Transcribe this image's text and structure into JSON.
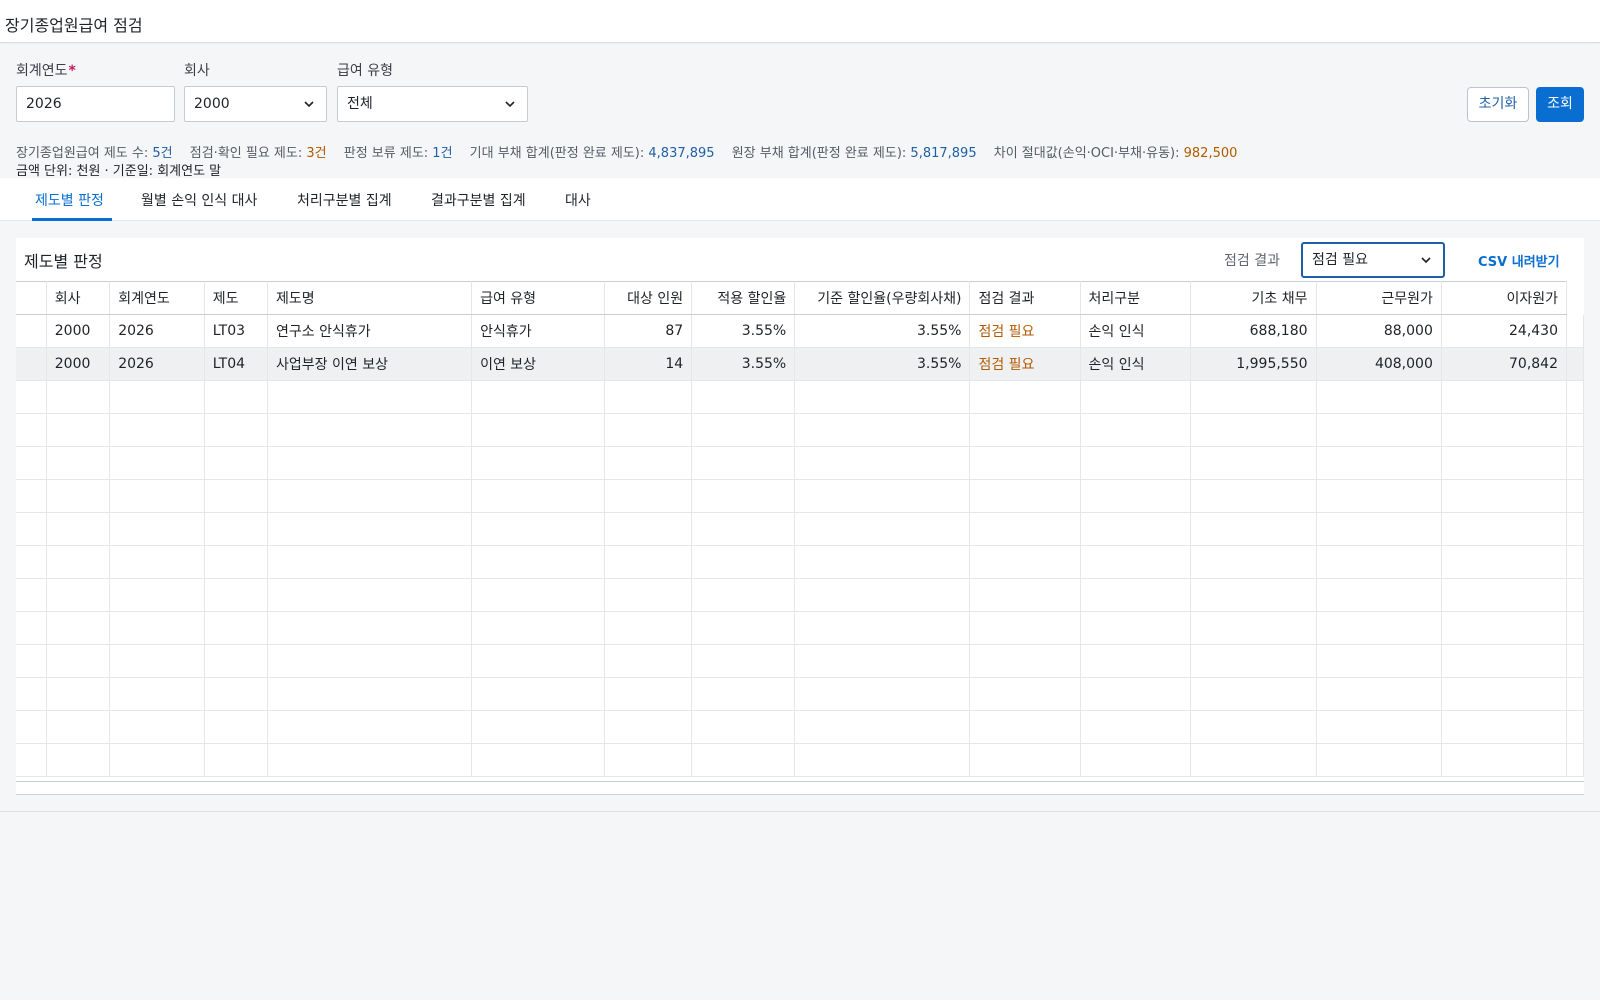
{
  "page": {
    "title": "장기종업원급여 점검"
  },
  "filters": {
    "year": {
      "label": "회계연도",
      "required_mark": "*",
      "value": "2026"
    },
    "company": {
      "label": "회사",
      "value": "2000"
    },
    "benefit_type": {
      "label": "급여 유형",
      "value": "전체"
    }
  },
  "actions": {
    "reset_label": "초기화",
    "search_label": "조회"
  },
  "summary": {
    "plan_count_label": "장기종업원급여 제도 수:",
    "plan_count": "5건",
    "needs_check_label": "점검·확인 필요 제도:",
    "needs_check": "3건",
    "pending_label": "판정 보류 제도:",
    "pending": "1건",
    "expected_label": "기대 부채 합계(판정 완료 제도):",
    "expected": "4,837,895",
    "ledger_label": "원장 부채 합계(판정 완료 제도):",
    "ledger": "5,817,895",
    "diff_label": "차이 절대값(손익·OCI·부채·유동):",
    "diff": "982,500",
    "unit_note": "금액 단위: 천원 · 기준일: 회계연도 말"
  },
  "tabs": [
    "제도별 판정",
    "월별 손익 인식 대사",
    "처리구분별 집계",
    "결과구분별 집계",
    "대사"
  ],
  "panel": {
    "title": "제도별 판정",
    "result_filter_label": "점검 결과",
    "result_filter_value": "점검 필요",
    "csv_label": "CSV 내려받기"
  },
  "table": {
    "columns": [
      "회사",
      "회계연도",
      "제도",
      "제도명",
      "급여 유형",
      "대상 인원",
      "적용 할인율",
      "기준 할인율(우량회사채)",
      "점검 결과",
      "처리구분",
      "기초 채무",
      "근무원가",
      "이자원가"
    ],
    "rows": [
      [
        "2000",
        "2026",
        "LT03",
        "연구소 안식휴가",
        "안식휴가",
        "87",
        "3.55%",
        "3.55%",
        "점검 필요",
        "손익 인식",
        "688,180",
        "88,000",
        "24,430"
      ],
      [
        "2000",
        "2026",
        "LT04",
        "사업부장 이연 보상",
        "이연 보상",
        "14",
        "3.55%",
        "3.55%",
        "점검 필요",
        "손익 인식",
        "1,995,550",
        "408,000",
        "70,842"
      ]
    ]
  },
  "colors": {
    "accent": "#0a6ed1",
    "warn": "#b35900",
    "value_blue": "#1f5fa8"
  },
  "icons": {
    "dropdown": "chevron-down-icon"
  }
}
